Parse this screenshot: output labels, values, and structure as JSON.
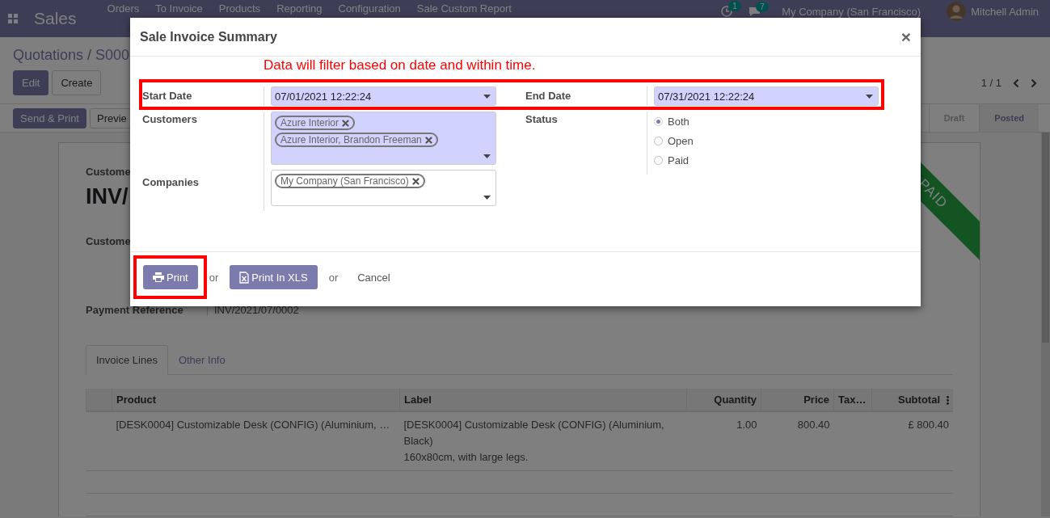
{
  "navbar": {
    "app_title": "Sales",
    "menu": [
      "Orders",
      "To Invoice",
      "Products",
      "Reporting",
      "Configuration",
      "Sale Custom Report"
    ],
    "activity_count": "1",
    "message_count": "7",
    "company": "My Company (San Francisco)",
    "user": "Mitchell Admin"
  },
  "breadcrumb": {
    "items": [
      "Quotations",
      "S000"
    ],
    "separator": "/"
  },
  "actions": [
    "Edit",
    "Create"
  ],
  "pager": "1 / 1",
  "form_buttons": [
    {
      "label": "Send & Print",
      "kind": "primary"
    },
    {
      "label": "Previe",
      "kind": "secondary"
    }
  ],
  "statusbar": [
    {
      "label": "Draft",
      "selected": false
    },
    {
      "label": "Posted",
      "selected": true
    }
  ],
  "sheet": {
    "ribbon": "PAID",
    "type_label": "Custome",
    "number": "INV/",
    "customer_label": "Custome",
    "payment_reference": {
      "label": "Payment Reference",
      "value": "INV/2021/07/0002"
    },
    "tabs": [
      {
        "label": "Invoice Lines",
        "selected": true
      },
      {
        "label": "Other Info",
        "selected": false
      }
    ],
    "table": {
      "columns": [
        "Product",
        "Label",
        "Quantity",
        "Price",
        "Tax…",
        "Subtotal"
      ],
      "rows": [
        {
          "product": "[DESK0004] Customizable Desk (CONFIG) (Aluminium, …",
          "label_lines": [
            "[DESK0004] Customizable Desk (CONFIG) (Aluminium, Black)",
            "160x80cm, with large legs."
          ],
          "quantity": "1.00",
          "price": "800.40",
          "subtotal": "£ 800.40"
        }
      ]
    }
  },
  "modal": {
    "title": "Sale Invoice Summary",
    "close": "×",
    "note": "Data will filter based on date and within time.",
    "dates": {
      "highlighted": true,
      "start": {
        "label": "Start Date",
        "value": "07/01/2021 12:22:24"
      },
      "end": {
        "label": "End Date",
        "value": "07/31/2021 12:22:24"
      }
    },
    "customers": {
      "label": "Customers",
      "required": true,
      "tags": [
        "Azure Interior",
        "Azure Interior, Brandon Freeman"
      ]
    },
    "companies": {
      "label": "Companies",
      "required": false,
      "tags": [
        "My Company (San Francisco)"
      ]
    },
    "status": {
      "label": "Status",
      "options": [
        {
          "label": "Both",
          "selected": true
        },
        {
          "label": "Open",
          "selected": false
        },
        {
          "label": "Paid",
          "selected": false
        }
      ]
    },
    "footer": [
      {
        "kind": "print",
        "label": "Print",
        "highlighted": true
      },
      {
        "kind": "text",
        "label": "or",
        "highlighted": false
      },
      {
        "kind": "export",
        "label": "Print In XLS",
        "highlighted": false
      },
      {
        "kind": "text",
        "label": "or",
        "highlighted": false
      },
      {
        "kind": "link",
        "label": "Cancel",
        "highlighted": false
      }
    ]
  }
}
